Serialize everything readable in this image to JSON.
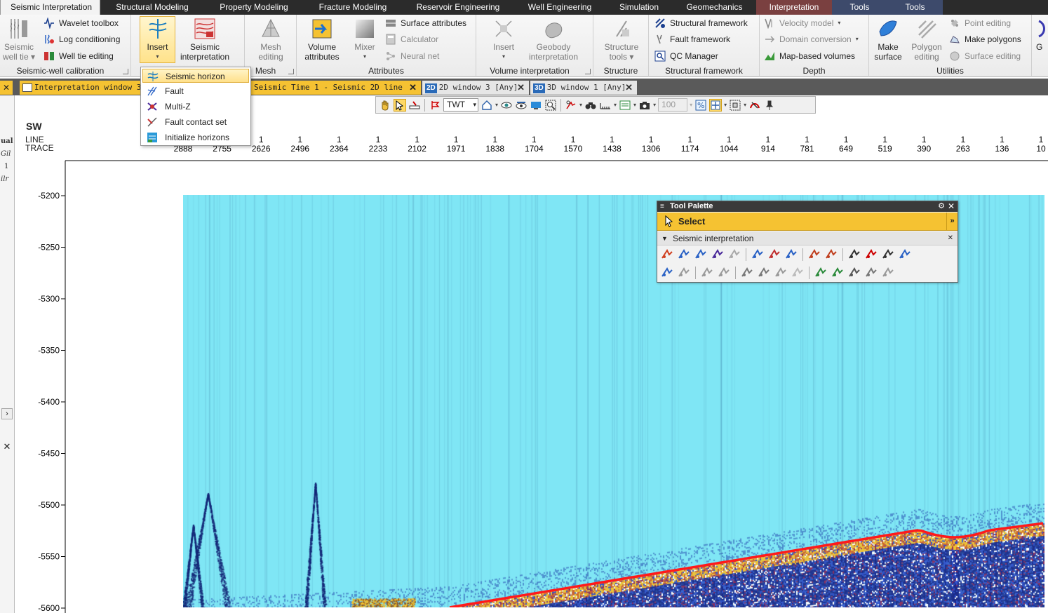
{
  "ribbon_tabs": [
    {
      "label": "Seismic Interpretation",
      "active": true
    },
    {
      "label": "Structural Modeling"
    },
    {
      "label": "Property Modeling"
    },
    {
      "label": "Fracture Modeling"
    },
    {
      "label": "Reservoir Engineering"
    },
    {
      "label": "Well Engineering"
    },
    {
      "label": "Simulation"
    },
    {
      "label": "Geomechanics"
    },
    {
      "label": "Interpretation",
      "context": true
    },
    {
      "label": "Tools"
    },
    {
      "label": "Tools"
    }
  ],
  "groups": {
    "seismic_well": {
      "label": "Seismic-well calibration",
      "big": {
        "line1": "Seismic",
        "line2": "well tie ▾"
      },
      "small": [
        "Wavelet toolbox",
        "Log conditioning",
        "Well tie editing"
      ]
    },
    "insert": {
      "label": "Insert",
      "interp_line1": "Seismic",
      "interp_line2": "interpretation"
    },
    "mesh": {
      "label": "Mesh",
      "line1": "Mesh",
      "line2": "editing"
    },
    "attributes": {
      "label": "Attributes",
      "vol_line1": "Volume",
      "vol_line2": "attributes",
      "mixer": "Mixer",
      "small": [
        "Surface attributes",
        "Calculator",
        "Neural net"
      ]
    },
    "volume_interp": {
      "label": "Volume interpretation",
      "insert": "Insert",
      "geobody_line1": "Geobody",
      "geobody_line2": "interpretation"
    },
    "structure": {
      "label": "Structure",
      "line1": "Structure",
      "line2": "tools ▾"
    },
    "structural_framework": {
      "label": "Structural framework",
      "small": [
        "Structural framework",
        "Fault framework",
        "QC Manager"
      ]
    },
    "depth": {
      "label": "Depth",
      "small": [
        "Velocity model",
        "Domain conversion",
        "Map-based volumes"
      ]
    },
    "utilities": {
      "label": "Utilities",
      "make_line1": "Make",
      "make_line2": "surface",
      "poly_line1": "Polygon",
      "poly_line2": "editing",
      "small": [
        "Point editing",
        "Make polygons",
        "Surface editing"
      ]
    },
    "edge_label": "G"
  },
  "dropdown": {
    "items": [
      "Seismic horizon",
      "Fault",
      "Multi-Z",
      "Fault contact set",
      "Initialize horizons"
    ],
    "highlighted": 0
  },
  "window_tabs": [
    {
      "label": "Interpretation window 3 [",
      "style": "yellow"
    },
    {
      "label": "Seismic Time 1 - Seismic 2D line",
      "style": "yellow"
    },
    {
      "badge": "2D",
      "label": "2D window 3 [Any]",
      "style": "gray"
    },
    {
      "badge": "3D",
      "label": "3D window 1 [Any]",
      "style": "gray"
    }
  ],
  "left_fragments": [
    "ual",
    "Gil",
    "1",
    "ilr"
  ],
  "toolbar": {
    "domain_select": "TWT",
    "opacity_value": "100"
  },
  "plot": {
    "direction": "SW",
    "line_label": "LINE",
    "trace_label": "TRACE",
    "traces": [
      "2888",
      "2755",
      "2626",
      "2496",
      "2364",
      "2233",
      "2102",
      "1971",
      "1838",
      "1704",
      "1570",
      "1438",
      "1306",
      "1174",
      "1044",
      "914",
      "781",
      "649",
      "519",
      "390",
      "263",
      "136",
      "10"
    ],
    "line_value": "1",
    "depths": [
      "-5200",
      "-5250",
      "-5300",
      "-5350",
      "-5400",
      "-5450",
      "-5500",
      "-5550",
      "-5600"
    ],
    "colors": {
      "background": "#7fe6f5",
      "horizon": "#ff1a1a",
      "yellow": "#f2c12e",
      "deep": "#1b2a8a"
    }
  },
  "palette": {
    "title": "Tool Palette",
    "select_label": "Select",
    "section_label": "Seismic interpretation"
  }
}
